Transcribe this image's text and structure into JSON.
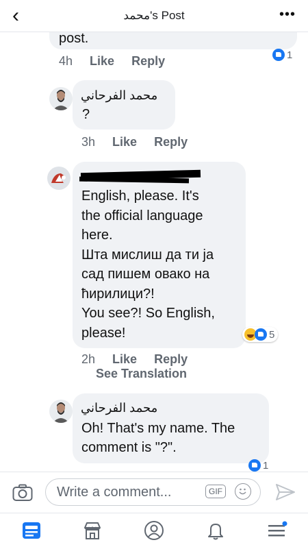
{
  "header": {
    "title": "محمد's Post"
  },
  "comments": [
    {
      "text": "post.",
      "time": "4h",
      "like": "Like",
      "reply": "Reply",
      "reactions": "1"
    },
    {
      "name": "محمد الفرحاني",
      "text": "?",
      "time": "3h",
      "like": "Like",
      "reply": "Reply"
    },
    {
      "lines": [
        "English, please. It's",
        "the official language",
        "here.",
        "Шта мислиш да ти ја",
        "сад пишем овако на",
        "ћирилици?!",
        "You see?! So English,",
        "please!"
      ],
      "time": "2h",
      "like": "Like",
      "reply": "Reply",
      "reactions": "5",
      "see_translation": "See Translation"
    },
    {
      "name": "محمد الفرحاني",
      "lines": [
        "Oh! That's my name. The",
        "comment is \"?\"."
      ],
      "reactions": "1"
    }
  ],
  "composer": {
    "placeholder": "Write a comment...",
    "gif": "GIF"
  },
  "colors": {
    "accent": "#1877f2",
    "bubble": "#f0f2f5"
  }
}
